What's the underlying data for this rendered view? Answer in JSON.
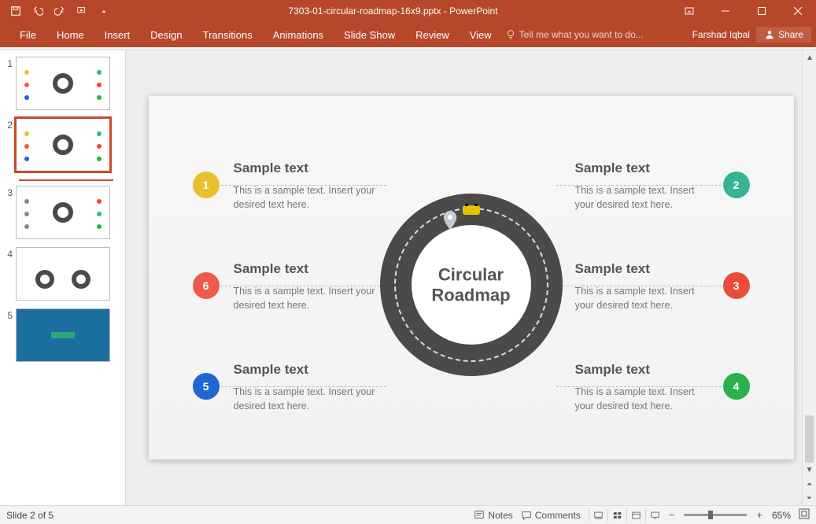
{
  "titlebar": {
    "filename": "7303-01-circular-roadmap-16x9.pptx - PowerPoint"
  },
  "ribbon": {
    "tabs": [
      "File",
      "Home",
      "Insert",
      "Design",
      "Transitions",
      "Animations",
      "Slide Show",
      "Review",
      "View"
    ],
    "tell_me": "Tell me what you want to do...",
    "user": "Farshad Iqbal",
    "share": "Share"
  },
  "thumbnails": {
    "count": 5,
    "selected": 2
  },
  "slide": {
    "center_line1": "Circular",
    "center_line2": "Roadmap",
    "items": [
      {
        "n": "1",
        "title": "Sample text",
        "body": "This is a sample text. Insert your desired text here."
      },
      {
        "n": "2",
        "title": "Sample text",
        "body": "This is a sample text. Insert your desired text here."
      },
      {
        "n": "3",
        "title": "Sample text",
        "body": "This is a sample text. Insert your desired text here."
      },
      {
        "n": "4",
        "title": "Sample text",
        "body": "This is a sample text. Insert your desired text here."
      },
      {
        "n": "5",
        "title": "Sample text",
        "body": "This is a sample text. Insert your desired text here."
      },
      {
        "n": "6",
        "title": "Sample text",
        "body": "This is a sample text. Insert your desired text here."
      }
    ]
  },
  "statusbar": {
    "slide_info": "Slide 2 of 5",
    "notes": "Notes",
    "comments": "Comments",
    "zoom": "65%"
  }
}
